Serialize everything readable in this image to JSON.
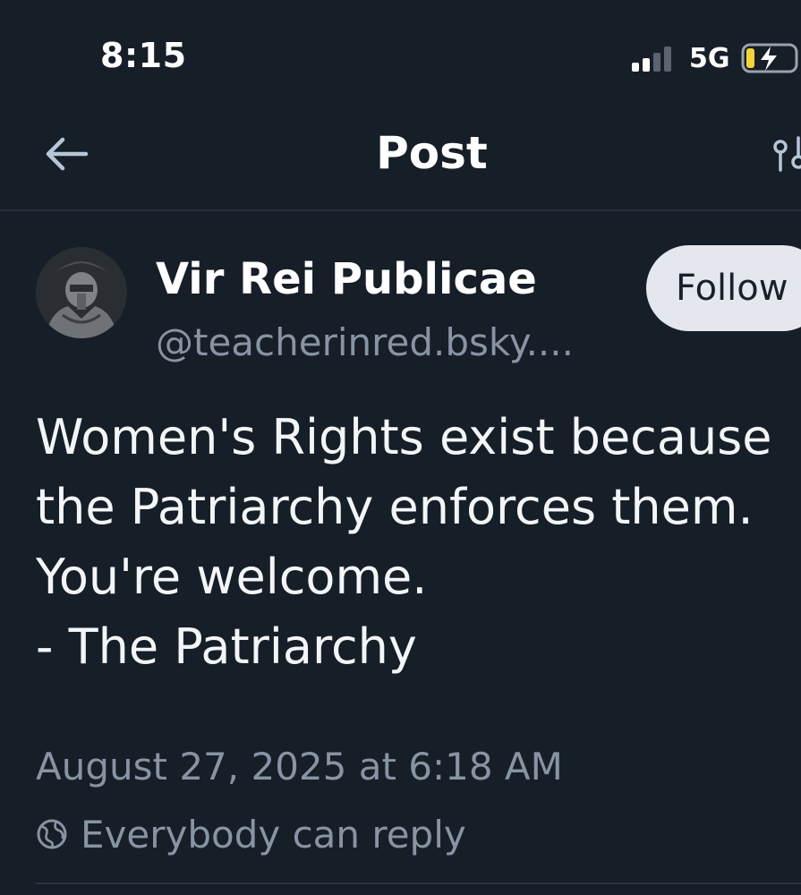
{
  "status_bar": {
    "time": "8:15",
    "network": "5G",
    "signal_icon": "cellular-signal-icon",
    "battery_icon": "battery-charging-icon"
  },
  "nav": {
    "title": "Post",
    "back_icon": "arrow-left-icon",
    "settings_icon": "sliders-icon"
  },
  "post": {
    "author": {
      "display_name": "Vir Rei Publicae",
      "handle": "@teacherinred.bsky....",
      "avatar_icon": "spartan-helmet-avatar"
    },
    "follow_label": "Follow",
    "body_lines": [
      "Women's Rights exist because",
      "the Patriarchy enforces them.",
      "You're welcome.",
      "- The Patriarchy"
    ],
    "timestamp": "August 27, 2025 at 6:18 AM",
    "reply_setting": "Everybody can reply",
    "reply_icon": "globe-icon"
  },
  "colors": {
    "background": "#161e27",
    "primary_text": "#f3f5f8",
    "secondary_text": "#8794a3",
    "follow_button_bg": "#e4e8ee",
    "divider": "#262f3a",
    "battery_bolt": "#f2d33a"
  }
}
